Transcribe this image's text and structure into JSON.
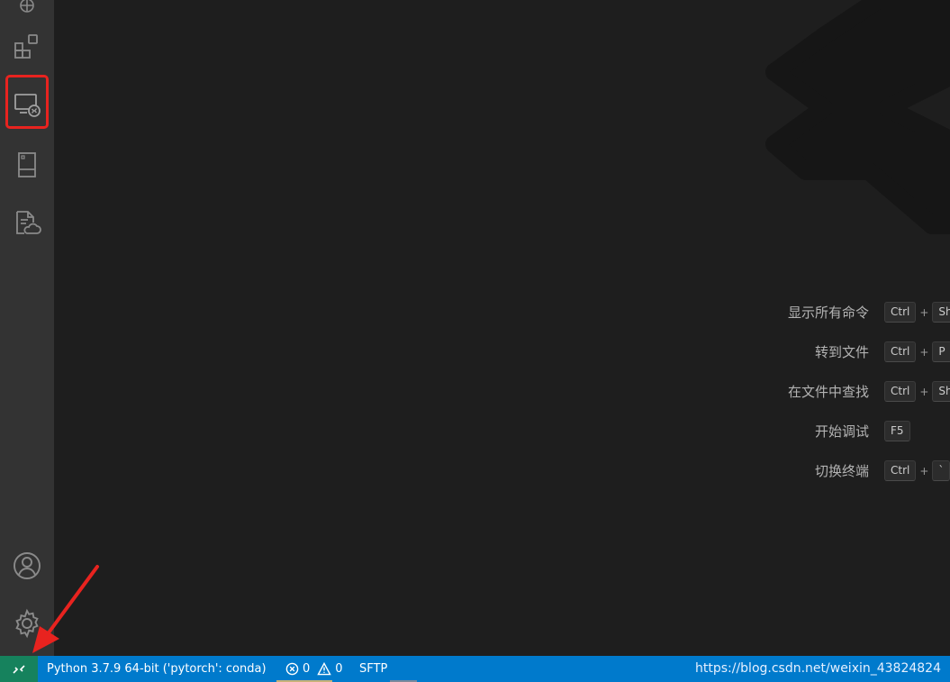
{
  "activity_bar": {
    "icons": [
      {
        "name": "extensions-icon"
      },
      {
        "name": "remote-explorer-icon"
      },
      {
        "name": "book-icon"
      },
      {
        "name": "cloud-file-icon"
      },
      {
        "name": "account-icon"
      },
      {
        "name": "gear-icon"
      }
    ],
    "highlight_color": "#e8231f"
  },
  "welcome": {
    "shortcuts": [
      {
        "label": "显示所有命令",
        "keys": [
          "Ctrl",
          "+",
          "Sh"
        ]
      },
      {
        "label": "转到文件",
        "keys": [
          "Ctrl",
          "+",
          "P"
        ]
      },
      {
        "label": "在文件中查找",
        "keys": [
          "Ctrl",
          "+",
          "Sh"
        ]
      },
      {
        "label": "开始调试",
        "keys": [
          "F5"
        ]
      },
      {
        "label": "切换终端",
        "keys": [
          "Ctrl",
          "+",
          "`"
        ]
      }
    ]
  },
  "status_bar": {
    "remote_icon": "remote-connection-icon",
    "python": "Python 3.7.9 64-bit ('pytorch': conda)",
    "errors": "0",
    "warnings": "0",
    "sftp": "SFTP",
    "url": "https://blog.csdn.net/weixin_43824824",
    "colors": {
      "background": "#007acc",
      "remote": "#16825d"
    }
  },
  "annotation": {
    "arrow_color": "#e8231f"
  }
}
